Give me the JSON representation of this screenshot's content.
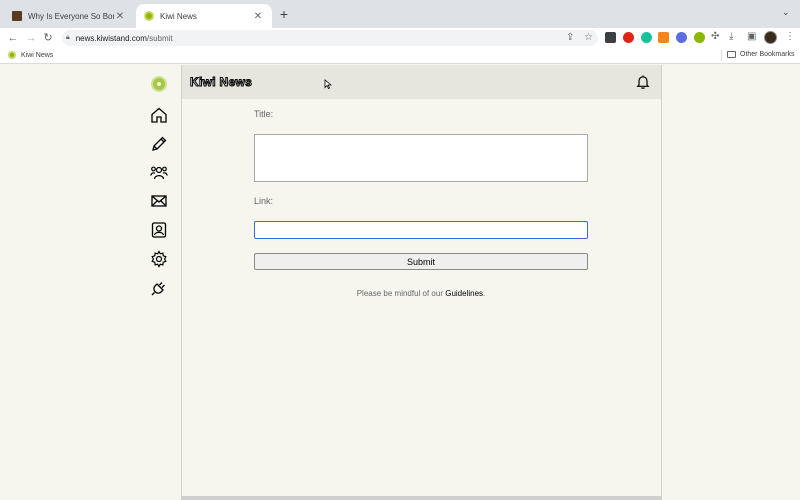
{
  "browser": {
    "tabs": [
      {
        "title": "Why Is Everyone So Boring? - I",
        "favicon": "book-cover-icon",
        "active": false
      },
      {
        "title": "Kiwi News",
        "favicon": "kiwi-icon",
        "active": true
      }
    ],
    "new_tab_symbol": "+",
    "url_host": "news.kiwistand.com",
    "url_path": "/submit",
    "bookmarks": [
      {
        "label": "Kiwi News",
        "icon": "kiwi-icon"
      }
    ],
    "other_bookmarks": "Other Bookmarks",
    "extensions": [
      {
        "name": "screen-ext-icon",
        "color": "#3c4043"
      },
      {
        "name": "opera-ext-icon",
        "color": "#e0241b"
      },
      {
        "name": "grammarly-ext-icon",
        "color": "#15c39a"
      },
      {
        "name": "metamask-ext-icon",
        "color": "#f6851b"
      },
      {
        "name": "settings-ext-icon",
        "color": "#5b6ee1"
      },
      {
        "name": "kiwi-ext-icon",
        "color": "#8db600"
      }
    ]
  },
  "page": {
    "brand": "Kiwi News",
    "title_label": "Title:",
    "title_value": "",
    "link_label": "Link:",
    "link_value": "",
    "submit_label": "Submit",
    "note_prefix": "Please be mindful of our ",
    "note_link": "Guidelines",
    "note_suffix": ".",
    "sidebar": [
      "home-icon",
      "pencil-icon",
      "community-icon",
      "mail-icon",
      "profile-icon",
      "settings-icon",
      "plug-icon"
    ]
  }
}
